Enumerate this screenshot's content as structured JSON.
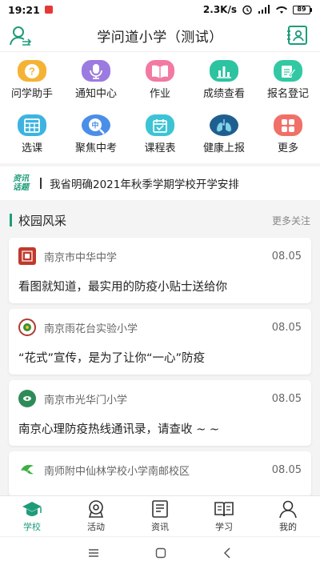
{
  "status_bar": {
    "time": "19:21",
    "speed": "2.3K/s",
    "battery": "89"
  },
  "header": {
    "title": "学问道小学（测试）"
  },
  "grid": [
    {
      "label": "问学助手",
      "icon": "question-icon",
      "color": "#f5b335"
    },
    {
      "label": "通知中心",
      "icon": "microphone-icon",
      "color": "#9b7be0"
    },
    {
      "label": "作业",
      "icon": "book-icon",
      "color": "#f27aa0"
    },
    {
      "label": "成绩查看",
      "icon": "bar-chart-icon",
      "color": "#2cc3a0"
    },
    {
      "label": "报名登记",
      "icon": "edit-icon",
      "color": "#33c8a4"
    },
    {
      "label": "选课",
      "icon": "table-icon",
      "color": "#3db4e0"
    },
    {
      "label": "聚焦中考",
      "icon": "search-icon",
      "color": "#4a8ee8"
    },
    {
      "label": "课程表",
      "icon": "calendar-icon",
      "color": "#3cc4d6"
    },
    {
      "label": "健康上报",
      "icon": "lungs-icon",
      "color": "#1f5f8f"
    },
    {
      "label": "更多",
      "icon": "grid-icon",
      "color": "#f07068"
    }
  ],
  "ticker": {
    "badge_line1": "资讯",
    "badge_line2": "话题",
    "text": "我省明确2021年秋季学期学校开学安排"
  },
  "section": {
    "title": "校园风采",
    "more": "更多关注"
  },
  "cards": [
    {
      "school": "南京市中华中学",
      "date": "08.05",
      "headline": "看图就知道，最实用的防疫小贴士送给你",
      "logo_color": "#c0392b"
    },
    {
      "school": "南京雨花台实验小学",
      "date": "08.05",
      "headline": "“花式”宣传，是为了让你“一心”防疫",
      "logo_color": "#b03a2e"
    },
    {
      "school": "南京市光华门小学",
      "date": "08.05",
      "headline": "南京心理防疫热线通讯录，请查收 ~ ~",
      "logo_color": "#2e8b57"
    },
    {
      "school": "南师附中仙林学校小学南邮校区",
      "date": "08.05",
      "headline": "",
      "logo_color": "#3cb043"
    }
  ],
  "tabs": [
    {
      "label": "学校",
      "icon": "graduation-cap-icon"
    },
    {
      "label": "活动",
      "icon": "location-pin-icon"
    },
    {
      "label": "资讯",
      "icon": "news-icon"
    },
    {
      "label": "学习",
      "icon": "open-book-icon"
    },
    {
      "label": "我的",
      "icon": "person-icon"
    }
  ],
  "accent_color": "#1e9c7a"
}
